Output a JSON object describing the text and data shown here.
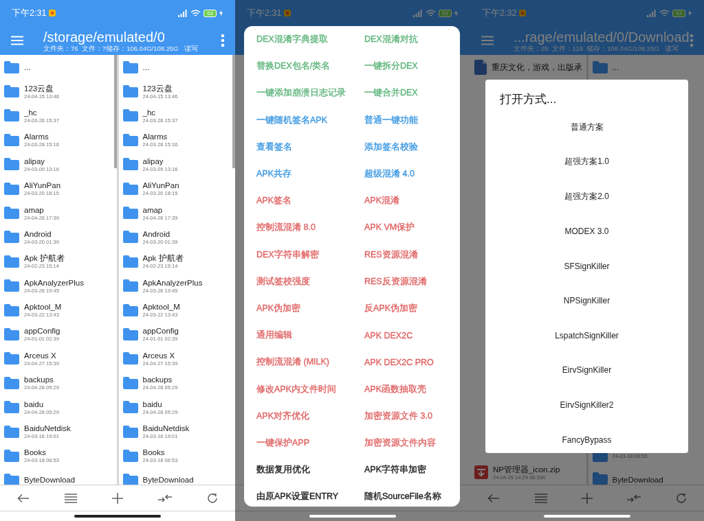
{
  "screens": [
    {
      "kind": "browser",
      "status_bar": {
        "time": "下午2:31",
        "battery": "53"
      },
      "toolbar": {
        "title": "/storage/emulated/0",
        "subtitle": "文件夹：76  文件：7储存：106.04G/108.25G   读写"
      },
      "panes": [
        {
          "items": [
            {
              "kind": "folder",
              "name": "..."
            },
            {
              "kind": "folder",
              "name": "123云盘",
              "date": "24-04-15 13:46"
            },
            {
              "kind": "folder",
              "name": "_hc",
              "date": "24-03-26 15:37"
            },
            {
              "kind": "folder",
              "name": "Alarms",
              "date": "24-03-28 15:16"
            },
            {
              "kind": "folder",
              "name": "alipay",
              "date": "24-03-09 13:16"
            },
            {
              "kind": "folder",
              "name": "AliYunPan",
              "date": "24-03-20 18:15"
            },
            {
              "kind": "folder",
              "name": "amap",
              "date": "24-04-26 17:39"
            },
            {
              "kind": "folder",
              "name": "Android",
              "date": "24-03-20 01:39"
            },
            {
              "kind": "folder",
              "name": "Apk 护航者",
              "date": "24-02-23 15:14"
            },
            {
              "kind": "folder",
              "name": "ApkAnalyzerPlus",
              "date": "24-03-26 19:45"
            },
            {
              "kind": "folder",
              "name": "Apktool_M",
              "date": "24-03-22 13:43"
            },
            {
              "kind": "folder",
              "name": "appConfig",
              "date": "24-01-01 02:39"
            },
            {
              "kind": "folder",
              "name": "Arceus X",
              "date": "24-04-27 15:39"
            },
            {
              "kind": "folder",
              "name": "backups",
              "date": "24-04-28 05:29"
            },
            {
              "kind": "folder",
              "name": "baidu",
              "date": "24-04-28 05:29"
            },
            {
              "kind": "folder",
              "name": "BaiduNetdisk",
              "date": "24-03-16 19:01"
            },
            {
              "kind": "folder",
              "name": "Books",
              "date": "24-03-18 06:53"
            },
            {
              "kind": "folder",
              "name": "ByteDownload"
            }
          ]
        },
        {
          "items": [
            {
              "kind": "folder",
              "name": "..."
            },
            {
              "kind": "folder",
              "name": "123云盘",
              "date": "24-04-15 13:46"
            },
            {
              "kind": "folder",
              "name": "_hc",
              "date": "24-03-26 15:37"
            },
            {
              "kind": "folder",
              "name": "Alarms",
              "date": "24-03-28 15:16"
            },
            {
              "kind": "folder",
              "name": "alipay",
              "date": "24-03-09 13:16"
            },
            {
              "kind": "folder",
              "name": "AliYunPan",
              "date": "24-03-20 18:15"
            },
            {
              "kind": "folder",
              "name": "amap",
              "date": "24-04-26 17:39"
            },
            {
              "kind": "folder",
              "name": "Android",
              "date": "24-03-20 01:39"
            },
            {
              "kind": "folder",
              "name": "Apk 护航者",
              "date": "24-02-23 15:14"
            },
            {
              "kind": "folder",
              "name": "ApkAnalyzerPlus",
              "date": "24-03-26 19:45"
            },
            {
              "kind": "folder",
              "name": "Apktool_M",
              "date": "24-03-22 13:43"
            },
            {
              "kind": "folder",
              "name": "appConfig",
              "date": "24-01-01 02:39"
            },
            {
              "kind": "folder",
              "name": "Arceus X",
              "date": "24-04-27 15:39"
            },
            {
              "kind": "folder",
              "name": "backups",
              "date": "24-04-28 05:29"
            },
            {
              "kind": "folder",
              "name": "baidu",
              "date": "24-04-28 05:29"
            },
            {
              "kind": "folder",
              "name": "BaiduNetdisk",
              "date": "24-03-16 19:01"
            },
            {
              "kind": "folder",
              "name": "Books",
              "date": "24-03-18 06:53"
            },
            {
              "kind": "folder",
              "name": "ByteDownload"
            }
          ]
        }
      ]
    },
    {
      "kind": "menu",
      "status_bar": {
        "time": "下午2:31",
        "battery": "53"
      },
      "menu": {
        "items": [
          {
            "label": "DEX混淆字典提取",
            "color": "#5fb57c"
          },
          {
            "label": "DEX混淆对抗",
            "color": "#5fb57c"
          },
          {
            "label": "替换DEX包名/类名",
            "color": "#5fb57c"
          },
          {
            "label": "一键拆分DEX",
            "color": "#5fb57c"
          },
          {
            "label": "一键添加崩溃日志记录",
            "color": "#5fb57c"
          },
          {
            "label": "一键合并DEX",
            "color": "#5fb57c"
          },
          {
            "label": "一键随机签名APK",
            "color": "#3d99e2"
          },
          {
            "label": "普通一键功能",
            "color": "#3d99e2"
          },
          {
            "label": "查看签名",
            "color": "#3d99e2"
          },
          {
            "label": "添加签名校验",
            "color": "#3d99e2"
          },
          {
            "label": "APK共存",
            "color": "#3d99e2"
          },
          {
            "label": "超级混淆 4.0",
            "color": "#3d99e2"
          },
          {
            "label": "APK签名",
            "color": "#e06666"
          },
          {
            "label": "APK混淆",
            "color": "#e06666"
          },
          {
            "label": "控制流混淆 8.0",
            "color": "#e06666"
          },
          {
            "label": "APK VM保护",
            "color": "#e06666"
          },
          {
            "label": "DEX字符串解密",
            "color": "#e06666"
          },
          {
            "label": "RES资源混淆",
            "color": "#e06666"
          },
          {
            "label": "测试签校强度",
            "color": "#e06666"
          },
          {
            "label": "RES反资源混淆",
            "color": "#e06666"
          },
          {
            "label": "APK伪加密",
            "color": "#e06666"
          },
          {
            "label": "反APK伪加密",
            "color": "#e06666"
          },
          {
            "label": "通用编辑",
            "color": "#e06666"
          },
          {
            "label": "APK DEX2C",
            "color": "#e06666"
          },
          {
            "label": "控制流混淆 (MILK)",
            "color": "#e06666"
          },
          {
            "label": "APK DEX2C PRO",
            "color": "#e06666"
          },
          {
            "label": "修改APK内文件时间",
            "color": "#e06666"
          },
          {
            "label": "APK函数抽取壳",
            "color": "#e06666"
          },
          {
            "label": "APK对齐优化",
            "color": "#e06666"
          },
          {
            "label": "加密资源文件 3.0",
            "color": "#e06666"
          },
          {
            "label": "一键保护APP",
            "color": "#e06666"
          },
          {
            "label": "加密资源文件内容",
            "color": "#e06666"
          },
          {
            "label": "数据复用优化",
            "color": "#222222"
          },
          {
            "label": "APK字符串加密",
            "color": "#222222"
          },
          {
            "label": "由原APK设置ENTRY",
            "color": "#222222"
          },
          {
            "label": "随机SourceFile名称",
            "color": "#222222"
          }
        ]
      }
    },
    {
      "kind": "open_with",
      "status_bar": {
        "time": "下午2:32",
        "battery": "53"
      },
      "toolbar": {
        "title": "...rage/emulated/0/Download",
        "subtitle": "文件夹：25  文件：118  储存：106.04G/108.25G   读写"
      },
      "panes": [
        {
          "items": [
            {
              "kind": "document",
              "name": "重庆文化，游戏，出版承"
            },
            {
              "kind": "archive",
              "name": "NP管理器_icon.zip",
              "date": "24-04-29 14:29  38.33K"
            }
          ]
        },
        {
          "items": [
            {
              "kind": "folder",
              "name": "..."
            },
            {
              "kind": "folder",
              "date": "24-03-18 06:53"
            },
            {
              "kind": "folder",
              "name": "ByteDownload"
            }
          ]
        }
      ],
      "dialog": {
        "title": "打开方式...",
        "options": [
          "普通方案",
          "超强方案1.0",
          "超强方案2.0",
          "MODEX 3.0",
          "SFSignKiller",
          "NPSignKiller",
          "LspatchSignKiller",
          "EirvSignKiller",
          "EirvSignKiller2",
          "FancyBypass"
        ]
      }
    }
  ]
}
